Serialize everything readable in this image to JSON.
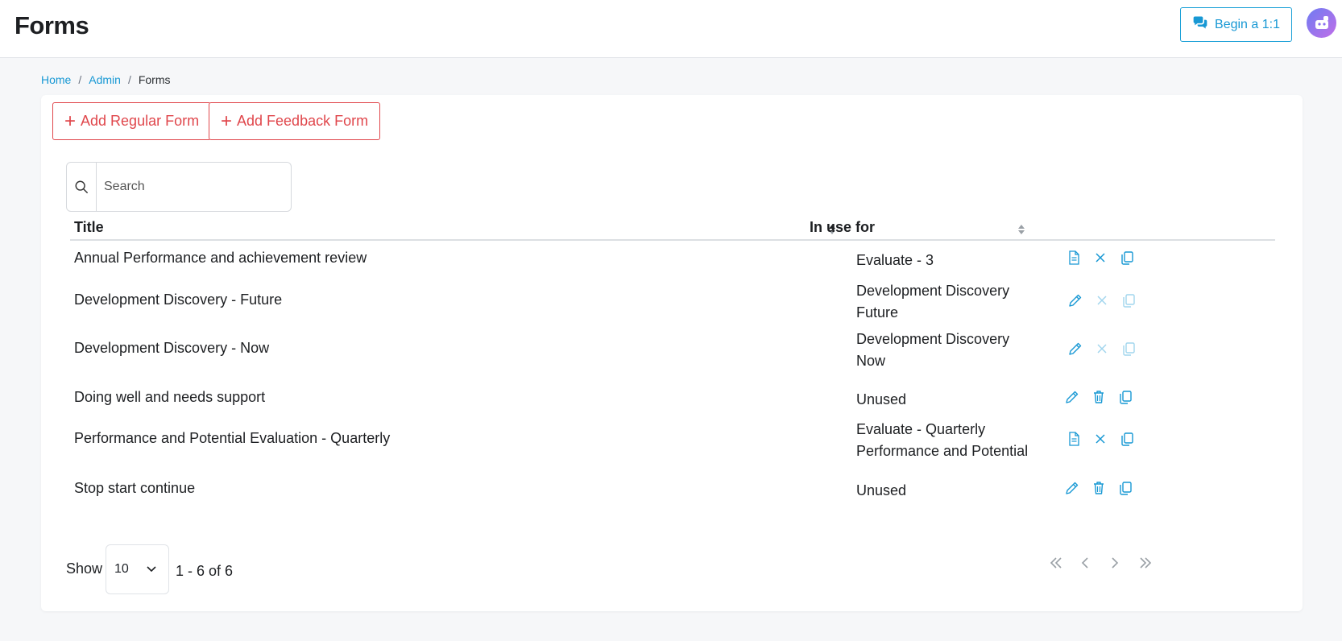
{
  "header": {
    "title": "Forms",
    "begin_label": "Begin a 1:1"
  },
  "breadcrumb": {
    "items": [
      "Home",
      "Admin",
      "Forms"
    ]
  },
  "toolbar": {
    "add_regular": "Add Regular Form",
    "add_feedback": "Add Feedback Form"
  },
  "search": {
    "placeholder": "Search",
    "value": ""
  },
  "table": {
    "columns": [
      "Title",
      "In use for"
    ],
    "rows": [
      {
        "title": "Annual Performance and achievement review",
        "use": [
          "Evaluate - 3"
        ],
        "actions": [
          "document-icon",
          "close-icon",
          "copy-icon"
        ],
        "faded": [
          false,
          false,
          false
        ]
      },
      {
        "title": "Development Discovery - Future",
        "use": [
          "Development Discovery",
          "Future"
        ],
        "actions": [
          "pencil-icon",
          "close-icon",
          "copy-icon"
        ],
        "faded": [
          false,
          true,
          true
        ]
      },
      {
        "title": "Development Discovery - Now",
        "use": [
          "Development Discovery",
          "Now"
        ],
        "actions": [
          "pencil-icon",
          "close-icon",
          "copy-icon"
        ],
        "faded": [
          false,
          true,
          true
        ]
      },
      {
        "title": "Doing well and needs support",
        "use": [
          "Unused"
        ],
        "actions": [
          "pencil-icon",
          "trash-icon",
          "copy-icon"
        ],
        "faded": [
          false,
          false,
          false
        ]
      },
      {
        "title": "Performance and Potential Evaluation - Quarterly",
        "use": [
          "Evaluate - Quarterly",
          "Performance and Potential"
        ],
        "actions": [
          "document-icon",
          "close-icon",
          "copy-icon"
        ],
        "faded": [
          false,
          false,
          false
        ]
      },
      {
        "title": "Stop start continue",
        "use": [
          "Unused"
        ],
        "actions": [
          "pencil-icon",
          "trash-icon",
          "copy-icon"
        ],
        "faded": [
          false,
          false,
          false
        ]
      }
    ]
  },
  "pagination": {
    "show_label": "Show",
    "page_size": "10",
    "range": "1 - 6 of 6"
  },
  "colors": {
    "accent": "#1798d4",
    "danger": "#e0474c"
  }
}
